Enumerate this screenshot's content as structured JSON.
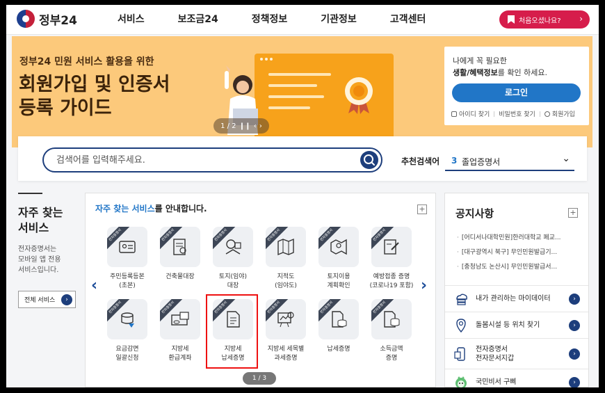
{
  "header": {
    "logo_text": "정부24",
    "nav": [
      "서비스",
      "보조금24",
      "정책정보",
      "기관정보",
      "고객센터"
    ],
    "start_button_label": "처음오셨나요?"
  },
  "banner": {
    "subtitle": "정부24 민원 서비스 활용을 위한",
    "title_line1": "회원가입 및 인증서",
    "title_line2": "등록 가이드",
    "pager": "1 / 2"
  },
  "login_card": {
    "line1": "나에게 꼭 필요한",
    "line2_bold": "생활/혜택정보",
    "line2_rest": "를 확인 하세요.",
    "login_button": "로그인",
    "links": [
      "아이디 찾기",
      "비밀번호 찾기",
      "회원가입"
    ]
  },
  "search": {
    "placeholder": "검색어를 입력해주세요.",
    "recommend_label": "추천검색어",
    "recommend_num": "3",
    "recommend_text": "졸업증명서"
  },
  "left_panel": {
    "title_line1": "자주 찾는",
    "title_line2": "서비스",
    "desc_line1": "전자증명서는",
    "desc_line2": "모바일 앱 전용",
    "desc_line3": "서비스입니다.",
    "all_services_label": "전체 서비스"
  },
  "services": {
    "heading_highlight": "자주 찾는 서비스",
    "heading_rest": "를 안내합니다.",
    "ribbon": "전자증명서",
    "pager": "1 / 3",
    "items": [
      {
        "line1": "주민등록등본",
        "line2": "(초본)",
        "icon": "id-card-icon"
      },
      {
        "line1": "건축물대장",
        "line2": "",
        "icon": "building-doc-icon"
      },
      {
        "line1": "토지(임야)",
        "line2": "대장",
        "icon": "land-register-icon"
      },
      {
        "line1": "지적도",
        "line2": "(임야도)",
        "icon": "cadastral-map-icon"
      },
      {
        "line1": "토지이용",
        "line2": "계획확인",
        "icon": "land-use-map-icon"
      },
      {
        "line1": "예방접종 증명",
        "line2": "(코로나19 포함)",
        "icon": "vaccine-doc-icon"
      },
      {
        "line1": "요금감면",
        "line2": "일괄신청",
        "icon": "coins-discount-icon"
      },
      {
        "line1": "지방세",
        "line2": "환급계좌",
        "icon": "tax-refund-icon"
      },
      {
        "line1": "지방세",
        "line2": "납세증명",
        "icon": "tax-document-icon"
      },
      {
        "line1": "지방세 세목별",
        "line2": "과세증명",
        "icon": "tax-chart-icon"
      },
      {
        "line1": "납세증명",
        "line2": "",
        "icon": "tax-payment-icon"
      },
      {
        "line1": "소득금액",
        "line2": "증명",
        "icon": "income-doc-icon"
      }
    ]
  },
  "notice": {
    "title": "공지사항",
    "items": [
      "[어디서나대학민원]한러대학교 폐교...",
      "[대구광역시 북구] 무인민원발급기...",
      "[충청남도 논산시] 무인민원발급서..."
    ],
    "quick_links": [
      {
        "line1": "내가 관리하는 마이데이터",
        "line2": ""
      },
      {
        "line1": "돌봄시설 등 위치 찾기",
        "line2": ""
      },
      {
        "line1": "전자증명서",
        "line2": "전자문서지갑"
      },
      {
        "line1": "국민비서 구삐",
        "line2": ""
      }
    ]
  }
}
